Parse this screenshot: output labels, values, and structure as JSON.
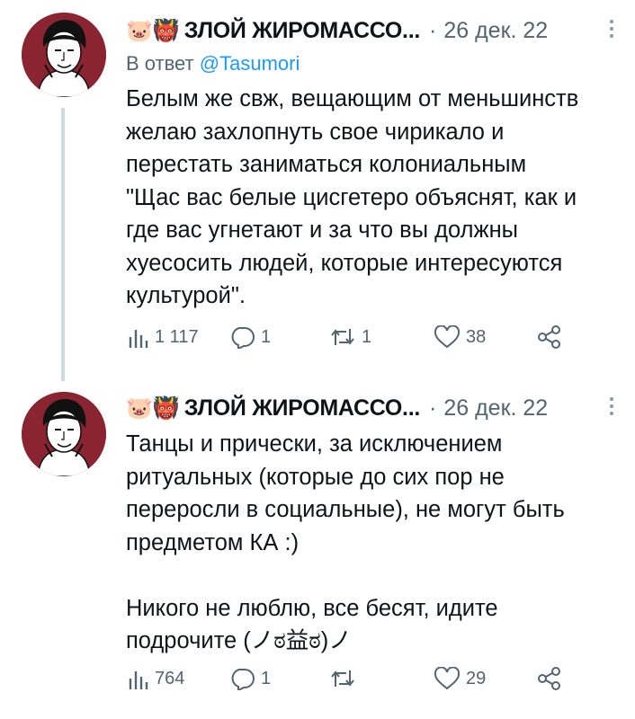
{
  "tweets": [
    {
      "author_emojis": "🐷👹",
      "author_name": "ЗЛОЙ ЖИРОМАССО...",
      "separator": "·",
      "date": "26 дек. 22",
      "reply_prefix": "В ответ",
      "reply_handle": "@Tasumori",
      "lines": [
        "Белым же свж, вещающим от меньшинств",
        "желаю захлопнуть свое чирикало и",
        "перестать заниматься колониальным",
        "\"Щас вас белые цисгетеро объяснят, как и",
        "где вас угнетают и за что вы должны",
        "хуесосить людей, которые интересуются",
        "культурой\"."
      ],
      "views": "1 117",
      "replies": "1",
      "retweets": "1",
      "likes": "38"
    },
    {
      "author_emojis": "🐷👹",
      "author_name": "ЗЛОЙ ЖИРОМАССО...",
      "separator": "·",
      "date": "26 дек. 22",
      "lines": [
        "Танцы и прически, за исключением",
        "ритуальных (которые до сих пор не",
        "переросли в социальные), не могут быть",
        "предметом КА :)",
        "",
        "Никого не люблю, все бесят, идите",
        "подрочите (ノಠ益ಠ)ノ"
      ],
      "views": "764",
      "replies": "1",
      "retweets": "",
      "likes": "29"
    }
  ],
  "colors": {
    "text": "#0f1419",
    "muted": "#536471",
    "link": "#1d9bf0",
    "thread": "#cfd9de",
    "avatar_bg": "#8a2431"
  },
  "icons": [
    "views-icon",
    "reply-icon",
    "retweet-icon",
    "like-icon",
    "share-icon",
    "more-icon"
  ]
}
